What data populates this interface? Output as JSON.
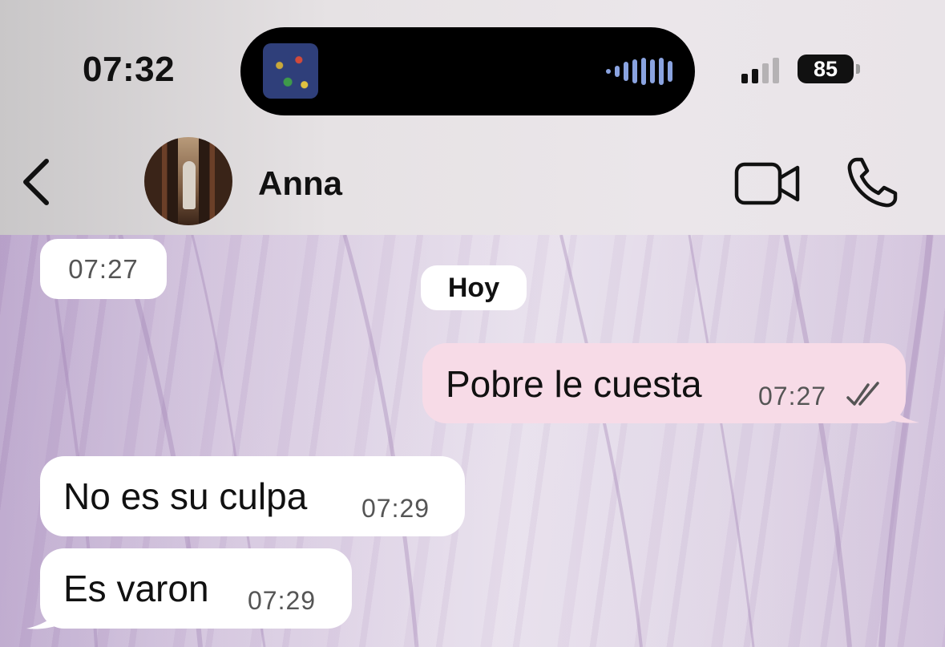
{
  "status_bar": {
    "time": "07:32",
    "battery": "85",
    "signal_bars_active": 2,
    "signal_bars_total": 4
  },
  "now_playing": {
    "album_art_icon": "album-art-icon",
    "activity_icon": "audio-waveform-icon"
  },
  "header": {
    "back_icon": "chevron-left-icon",
    "contact_name": "Anna",
    "video_icon": "video-camera-icon",
    "call_icon": "phone-icon"
  },
  "chat": {
    "prev_time_chip": "07:27",
    "date_separator": "Hoy",
    "messages": [
      {
        "direction": "outgoing",
        "text": "Pobre le cuesta",
        "time": "07:27",
        "status_icon": "double-check-icon"
      },
      {
        "direction": "incoming",
        "text": "No es su culpa",
        "time": "07:29"
      },
      {
        "direction": "incoming",
        "text": "Es varon",
        "time": "07:29"
      }
    ]
  },
  "colors": {
    "outgoing_bubble": "#f7dbe7",
    "incoming_bubble": "#ffffff",
    "wallpaper": "#cdbcd9"
  }
}
